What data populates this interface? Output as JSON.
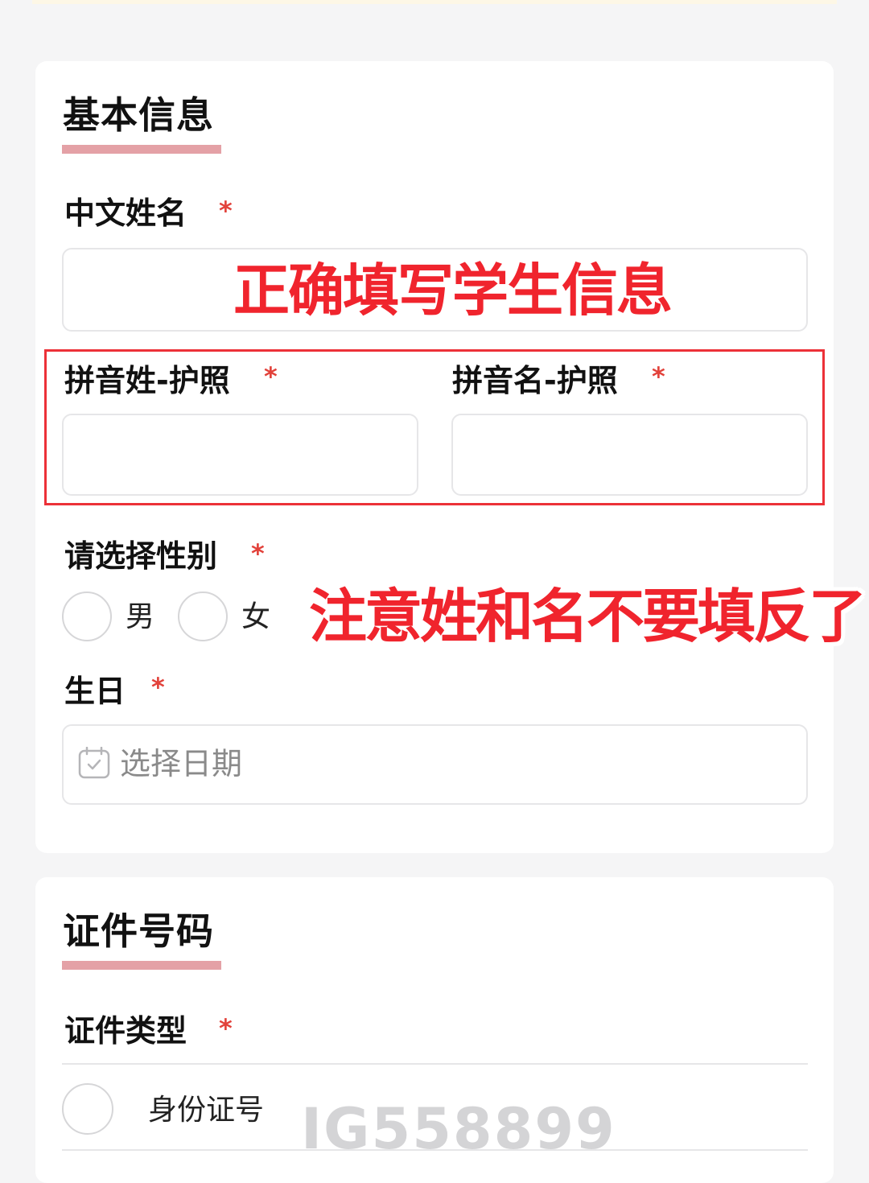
{
  "basic_info": {
    "title": "基本信息",
    "chinese_name": {
      "label": "中文姓名",
      "required_mark": "*"
    },
    "pinyin_surname": {
      "label": "拼音姓-护照",
      "required_mark": "*"
    },
    "pinyin_given_name": {
      "label": "拼音名-护照",
      "required_mark": "*"
    },
    "gender": {
      "label": "请选择性别",
      "required_mark": "*",
      "options": [
        "男",
        "女"
      ]
    },
    "birthday": {
      "label": "生日",
      "required_mark": "*",
      "placeholder": "选择日期",
      "icon": "calendar-icon"
    }
  },
  "id_section": {
    "title": "证件号码",
    "id_type": {
      "label": "证件类型",
      "required_mark": "*",
      "options": [
        "身份证号"
      ]
    }
  },
  "annotations": {
    "overlay_top": "正确填写学生信息",
    "overlay_middle": "注意姓和名不要填反了",
    "highlight_color": "#ec3138"
  },
  "watermark": "IG558899",
  "colors": {
    "accent_underline": "#e4a1a6",
    "required_star": "#e2423b",
    "annotation_red": "#f0242d"
  }
}
